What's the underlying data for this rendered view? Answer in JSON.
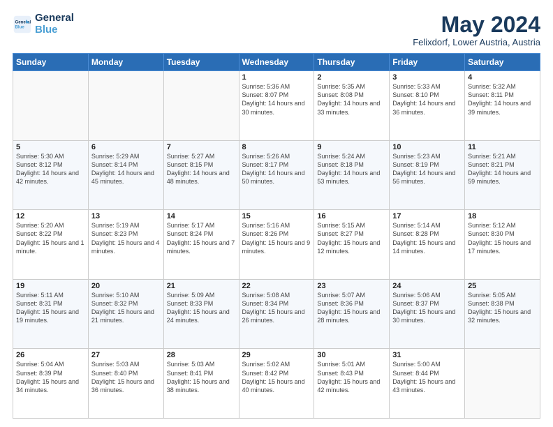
{
  "logo": {
    "line1": "General",
    "line2": "Blue"
  },
  "title": "May 2024",
  "subtitle": "Felixdorf, Lower Austria, Austria",
  "days_of_week": [
    "Sunday",
    "Monday",
    "Tuesday",
    "Wednesday",
    "Thursday",
    "Friday",
    "Saturday"
  ],
  "weeks": [
    [
      {
        "day": "",
        "sunrise": "",
        "sunset": "",
        "daylight": ""
      },
      {
        "day": "",
        "sunrise": "",
        "sunset": "",
        "daylight": ""
      },
      {
        "day": "",
        "sunrise": "",
        "sunset": "",
        "daylight": ""
      },
      {
        "day": "1",
        "sunrise": "Sunrise: 5:36 AM",
        "sunset": "Sunset: 8:07 PM",
        "daylight": "Daylight: 14 hours and 30 minutes."
      },
      {
        "day": "2",
        "sunrise": "Sunrise: 5:35 AM",
        "sunset": "Sunset: 8:08 PM",
        "daylight": "Daylight: 14 hours and 33 minutes."
      },
      {
        "day": "3",
        "sunrise": "Sunrise: 5:33 AM",
        "sunset": "Sunset: 8:10 PM",
        "daylight": "Daylight: 14 hours and 36 minutes."
      },
      {
        "day": "4",
        "sunrise": "Sunrise: 5:32 AM",
        "sunset": "Sunset: 8:11 PM",
        "daylight": "Daylight: 14 hours and 39 minutes."
      }
    ],
    [
      {
        "day": "5",
        "sunrise": "Sunrise: 5:30 AM",
        "sunset": "Sunset: 8:12 PM",
        "daylight": "Daylight: 14 hours and 42 minutes."
      },
      {
        "day": "6",
        "sunrise": "Sunrise: 5:29 AM",
        "sunset": "Sunset: 8:14 PM",
        "daylight": "Daylight: 14 hours and 45 minutes."
      },
      {
        "day": "7",
        "sunrise": "Sunrise: 5:27 AM",
        "sunset": "Sunset: 8:15 PM",
        "daylight": "Daylight: 14 hours and 48 minutes."
      },
      {
        "day": "8",
        "sunrise": "Sunrise: 5:26 AM",
        "sunset": "Sunset: 8:17 PM",
        "daylight": "Daylight: 14 hours and 50 minutes."
      },
      {
        "day": "9",
        "sunrise": "Sunrise: 5:24 AM",
        "sunset": "Sunset: 8:18 PM",
        "daylight": "Daylight: 14 hours and 53 minutes."
      },
      {
        "day": "10",
        "sunrise": "Sunrise: 5:23 AM",
        "sunset": "Sunset: 8:19 PM",
        "daylight": "Daylight: 14 hours and 56 minutes."
      },
      {
        "day": "11",
        "sunrise": "Sunrise: 5:21 AM",
        "sunset": "Sunset: 8:21 PM",
        "daylight": "Daylight: 14 hours and 59 minutes."
      }
    ],
    [
      {
        "day": "12",
        "sunrise": "Sunrise: 5:20 AM",
        "sunset": "Sunset: 8:22 PM",
        "daylight": "Daylight: 15 hours and 1 minute."
      },
      {
        "day": "13",
        "sunrise": "Sunrise: 5:19 AM",
        "sunset": "Sunset: 8:23 PM",
        "daylight": "Daylight: 15 hours and 4 minutes."
      },
      {
        "day": "14",
        "sunrise": "Sunrise: 5:17 AM",
        "sunset": "Sunset: 8:24 PM",
        "daylight": "Daylight: 15 hours and 7 minutes."
      },
      {
        "day": "15",
        "sunrise": "Sunrise: 5:16 AM",
        "sunset": "Sunset: 8:26 PM",
        "daylight": "Daylight: 15 hours and 9 minutes."
      },
      {
        "day": "16",
        "sunrise": "Sunrise: 5:15 AM",
        "sunset": "Sunset: 8:27 PM",
        "daylight": "Daylight: 15 hours and 12 minutes."
      },
      {
        "day": "17",
        "sunrise": "Sunrise: 5:14 AM",
        "sunset": "Sunset: 8:28 PM",
        "daylight": "Daylight: 15 hours and 14 minutes."
      },
      {
        "day": "18",
        "sunrise": "Sunrise: 5:12 AM",
        "sunset": "Sunset: 8:30 PM",
        "daylight": "Daylight: 15 hours and 17 minutes."
      }
    ],
    [
      {
        "day": "19",
        "sunrise": "Sunrise: 5:11 AM",
        "sunset": "Sunset: 8:31 PM",
        "daylight": "Daylight: 15 hours and 19 minutes."
      },
      {
        "day": "20",
        "sunrise": "Sunrise: 5:10 AM",
        "sunset": "Sunset: 8:32 PM",
        "daylight": "Daylight: 15 hours and 21 minutes."
      },
      {
        "day": "21",
        "sunrise": "Sunrise: 5:09 AM",
        "sunset": "Sunset: 8:33 PM",
        "daylight": "Daylight: 15 hours and 24 minutes."
      },
      {
        "day": "22",
        "sunrise": "Sunrise: 5:08 AM",
        "sunset": "Sunset: 8:34 PM",
        "daylight": "Daylight: 15 hours and 26 minutes."
      },
      {
        "day": "23",
        "sunrise": "Sunrise: 5:07 AM",
        "sunset": "Sunset: 8:36 PM",
        "daylight": "Daylight: 15 hours and 28 minutes."
      },
      {
        "day": "24",
        "sunrise": "Sunrise: 5:06 AM",
        "sunset": "Sunset: 8:37 PM",
        "daylight": "Daylight: 15 hours and 30 minutes."
      },
      {
        "day": "25",
        "sunrise": "Sunrise: 5:05 AM",
        "sunset": "Sunset: 8:38 PM",
        "daylight": "Daylight: 15 hours and 32 minutes."
      }
    ],
    [
      {
        "day": "26",
        "sunrise": "Sunrise: 5:04 AM",
        "sunset": "Sunset: 8:39 PM",
        "daylight": "Daylight: 15 hours and 34 minutes."
      },
      {
        "day": "27",
        "sunrise": "Sunrise: 5:03 AM",
        "sunset": "Sunset: 8:40 PM",
        "daylight": "Daylight: 15 hours and 36 minutes."
      },
      {
        "day": "28",
        "sunrise": "Sunrise: 5:03 AM",
        "sunset": "Sunset: 8:41 PM",
        "daylight": "Daylight: 15 hours and 38 minutes."
      },
      {
        "day": "29",
        "sunrise": "Sunrise: 5:02 AM",
        "sunset": "Sunset: 8:42 PM",
        "daylight": "Daylight: 15 hours and 40 minutes."
      },
      {
        "day": "30",
        "sunrise": "Sunrise: 5:01 AM",
        "sunset": "Sunset: 8:43 PM",
        "daylight": "Daylight: 15 hours and 42 minutes."
      },
      {
        "day": "31",
        "sunrise": "Sunrise: 5:00 AM",
        "sunset": "Sunset: 8:44 PM",
        "daylight": "Daylight: 15 hours and 43 minutes."
      },
      {
        "day": "",
        "sunrise": "",
        "sunset": "",
        "daylight": ""
      }
    ]
  ]
}
